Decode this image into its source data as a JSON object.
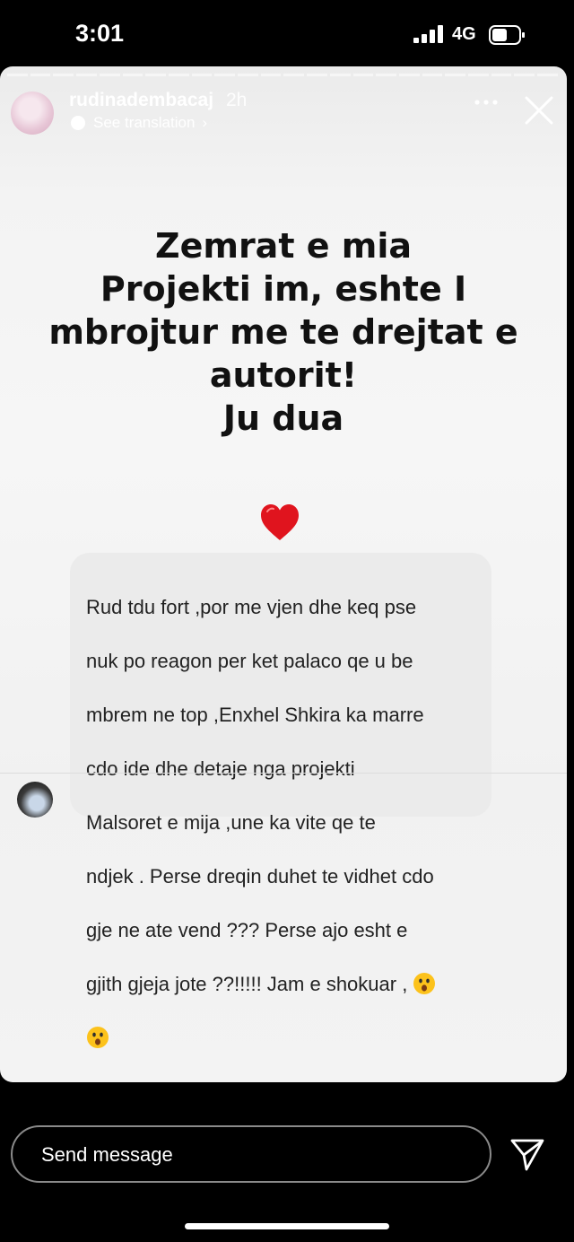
{
  "status_bar": {
    "time": "3:01",
    "network": "4G"
  },
  "story": {
    "username": "rudinadembacaj",
    "time_ago": "2h",
    "translate_label": "See translation",
    "headline_lines": [
      "Zemrat e mia",
      "Projekti im, eshte I",
      "mbrojtur me te drejtat e",
      "autorit!",
      "Ju dua"
    ],
    "heart_icon": "red-heart-icon",
    "reply": {
      "lines": [
        "Rud tdu fort ,por me vjen dhe keq pse",
        "nuk po reagon per ket palaco qe u be",
        "mbrem ne top ,Enxhel Shkira ka marre",
        "cdo ide dhe detaje nga projekti",
        "Malsoret e mija ,une ka vite qe te",
        "ndjek . Perse dreqin duhet te vidhet cdo",
        "gje ne ate vend ??? Perse ajo esht e",
        "gjith gjeja jote ??!!!!! Jam e shokuar ,"
      ],
      "emoji": "surprised-face-emoji"
    }
  },
  "composer": {
    "placeholder": "Send message"
  },
  "colors": {
    "bubble": "#ebebeb",
    "heart": "#e0141e",
    "background": "#000000"
  }
}
